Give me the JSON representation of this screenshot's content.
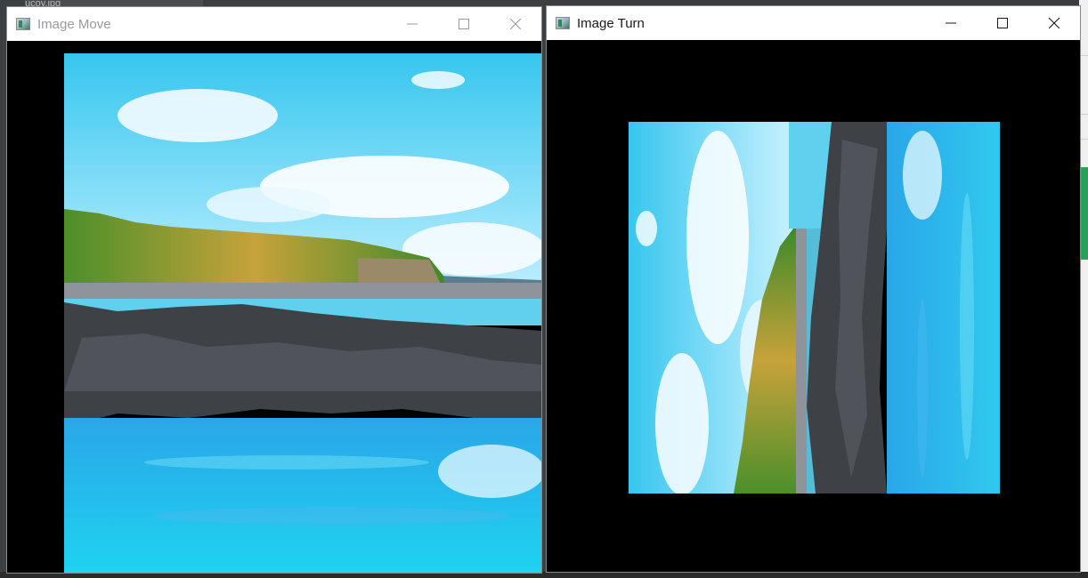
{
  "background": {
    "top_tab_text": "ucoy.jpg"
  },
  "windows": [
    {
      "id": "move",
      "title": "Image Move",
      "active": false,
      "controls": [
        "minimize-icon",
        "maximize-icon",
        "close-icon"
      ]
    },
    {
      "id": "turn",
      "title": "Image Turn",
      "active": true,
      "controls": [
        "minimize-icon",
        "maximize-icon",
        "close-icon"
      ]
    }
  ],
  "colors": {
    "title_active": "#1a1a1a",
    "title_inactive": "#9a9a9a",
    "client_bg": "#000000",
    "sky": "#3fd0ee",
    "sea": "#1b9ee6",
    "rock": "#3a3c40",
    "grass": "#5f9c2a"
  },
  "scene": {
    "description_icon": "seascape-photo"
  }
}
